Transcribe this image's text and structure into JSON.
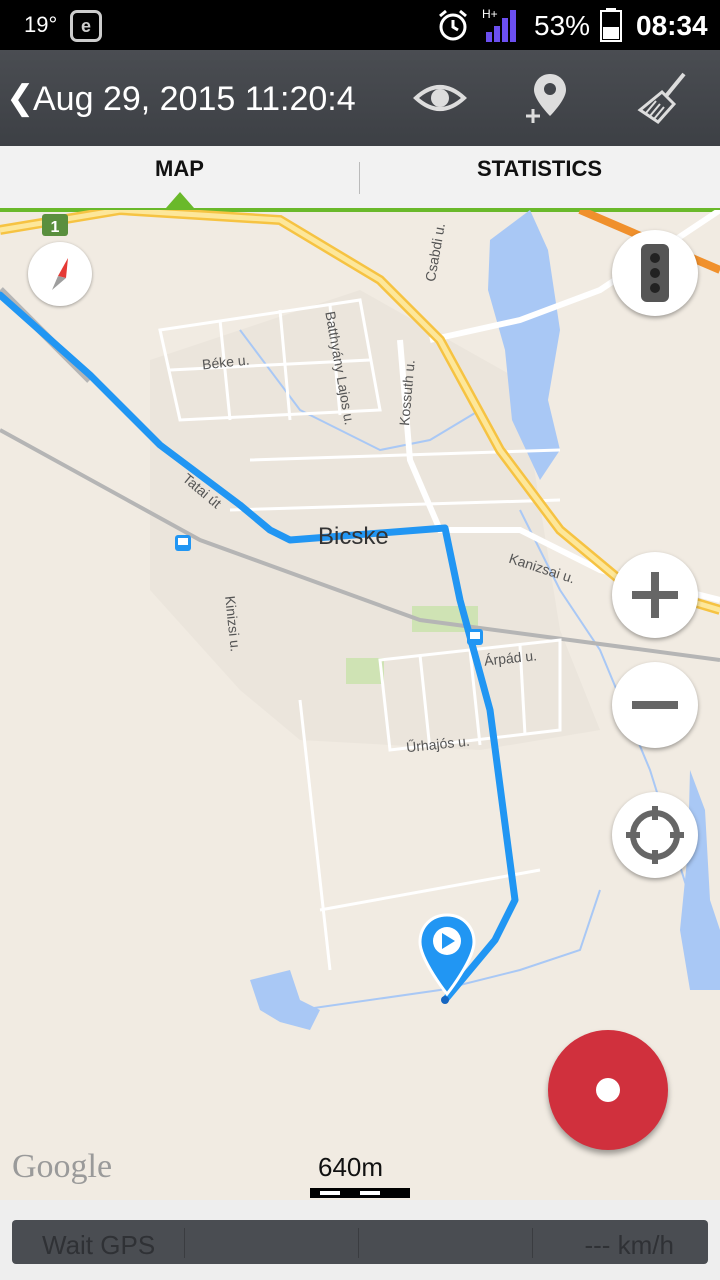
{
  "status_bar": {
    "temperature": "19°",
    "e_badge": "e",
    "signal_type": "H+",
    "battery_percent": "53%",
    "time": "08:34",
    "icons": [
      "alarm-icon",
      "signal-icon",
      "battery-icon"
    ]
  },
  "action_bar": {
    "back_glyph": "❮",
    "title": "Aug 29, 2015 11:20:4",
    "buttons": [
      "eye-icon",
      "add-location-icon",
      "broom-icon"
    ]
  },
  "tabs": [
    {
      "label": "MAP",
      "selected": true
    },
    {
      "label": "STATISTICS",
      "selected": false
    }
  ],
  "map": {
    "city": "Bicske",
    "highway_shield": "1",
    "streets": [
      "Csabdi u.",
      "Batthyány Lajos u.",
      "Béke u.",
      "Kossuth u.",
      "Tatai út",
      "Kanizsai u.",
      "Kinizsi u.",
      "Árpád u.",
      "Űrhajós u."
    ],
    "attribution": "Google",
    "scale": "640m",
    "controls": [
      "compass-icon",
      "traffic-icon",
      "zoom-in-icon",
      "zoom-out-icon",
      "locate-icon"
    ],
    "route_color": "#2196f3"
  },
  "record_button": {
    "color": "#d0303d"
  },
  "footer": {
    "gps_status": "Wait GPS",
    "speed": "--- km/h"
  }
}
